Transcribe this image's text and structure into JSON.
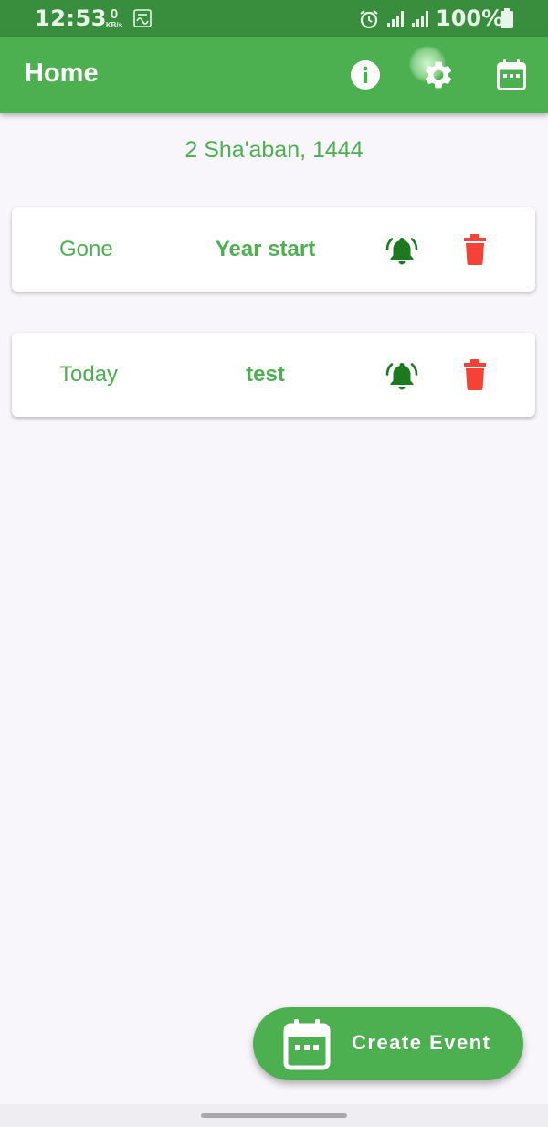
{
  "status_bar": {
    "time": "12:53",
    "speed_value": "0",
    "speed_unit": "KB/s",
    "battery": "100%"
  },
  "app_bar": {
    "title": "Home",
    "icons": [
      "info-icon",
      "settings-icon",
      "calendar-icon"
    ]
  },
  "hijri_date": "2 Sha'aban, 1444",
  "events": [
    {
      "status": "Gone",
      "name": "Year start"
    },
    {
      "status": "Today",
      "name": "test"
    }
  ],
  "fab": {
    "label": "Create Event"
  },
  "colors": {
    "primary": "#4caf50",
    "status_bar": "#388e3c",
    "bell": "#1b7a1f",
    "delete": "#f44336",
    "background": "#f8f6fa"
  }
}
